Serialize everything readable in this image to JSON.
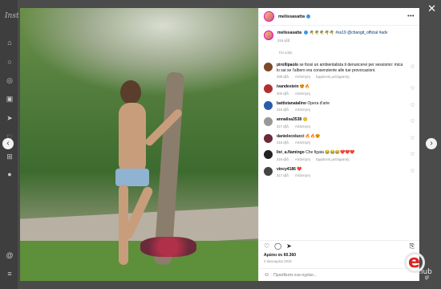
{
  "app": {
    "logo": "Inst"
  },
  "post": {
    "username": "melissasatta",
    "caption_emojis": "🌴🌴🌴🌴🌴",
    "caption_tags": "#ss19 @changit_official #adv",
    "caption_time": "318 εβδ.",
    "translate": "Για εσάς"
  },
  "comments": [
    {
      "user": "pirollipaolo",
      "text": "se fossi un ambientalista ti denuncerei per sessismo: mica lo sai se l'albero era consenziente alle tue provocazioni.",
      "time": "298 εβδ.",
      "reply": "Απάντηση",
      "extra": "Εμφάνιση μετάφρασης",
      "color": "#7a4a2a"
    },
    {
      "user": "ivandestein",
      "text": "😍🔥",
      "time": "300 εβδ.",
      "reply": "Απάντηση",
      "extra": "",
      "color": "#b03030"
    },
    {
      "user": "battistanatalino",
      "text": "Opera d'arte",
      "time": "316 εβδ.",
      "reply": "Απάντηση",
      "extra": "",
      "color": "#2a5caa"
    },
    {
      "user": "annalisa3538",
      "text": "😊",
      "time": "317 εβδ.",
      "reply": "Απάντηση",
      "extra": "",
      "color": "#999999"
    },
    {
      "user": "danielecolucci",
      "text": "🔥🔥😍",
      "time": "316 εβδ.",
      "reply": "Απάντηση",
      "extra": "",
      "color": "#6a2a3a"
    },
    {
      "user": "livi_a.flamingo",
      "text": "Che figata 😂😂😂❤️❤️❤️",
      "time": "316 εβδ.",
      "reply": "Απάντηση",
      "extra": "Εμφάνιση μετάφρασης",
      "color": "#222222"
    },
    {
      "user": "vincy4186",
      "text": "❤️",
      "time": "317 εβδ.",
      "reply": "Απάντηση",
      "extra": "",
      "color": "#444444"
    }
  ],
  "footer": {
    "likes": "Αρέσει σε 60.360",
    "date": "2 Ιανουαρίου 2019",
    "comment_placeholder": "Προσθέστε ένα σχόλιο..."
  },
  "watermark": {
    "brand": "club",
    "tld": "gr"
  }
}
